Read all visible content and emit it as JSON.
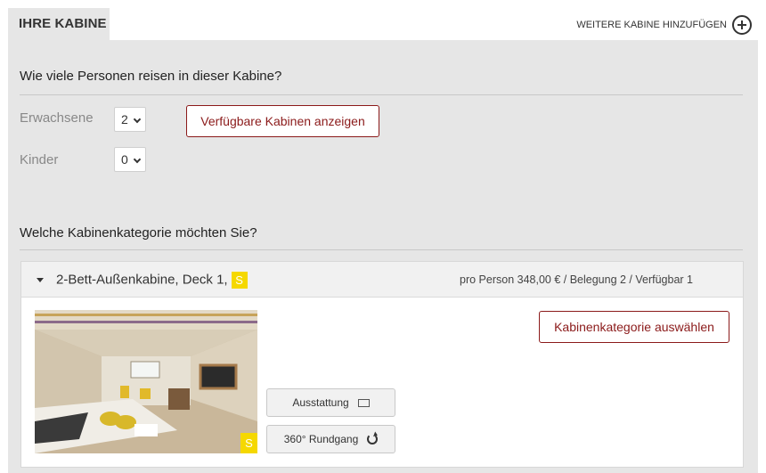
{
  "header": {
    "tab_label": "IHRE KABINE",
    "add_cabin_label": "WEITERE KABINE HINZUFÜGEN"
  },
  "persons": {
    "title": "Wie viele Personen reisen in dieser Kabine?",
    "adults_label": "Erwachsene",
    "adults_value": "2",
    "children_label": "Kinder",
    "children_value": "0",
    "show_cabins_button": "Verfügbare Kabinen anzeigen"
  },
  "category": {
    "title": "Welche Kabinenkategorie möchten Sie?",
    "card": {
      "name": "2-Bett-Außenkabine, Deck 1,",
      "badge": "S",
      "meta": "pro Person 348,00  € / Belegung 2 / Verfügbar 1",
      "select_button": "Kabinenkategorie auswählen",
      "photo_badge": "S",
      "equipment_button": "Ausstattung",
      "tour_button": "360° Rundgang"
    }
  },
  "colors": {
    "accent": "#8b1a1a",
    "badge": "#f5d800",
    "panel": "#e6e6e6"
  }
}
